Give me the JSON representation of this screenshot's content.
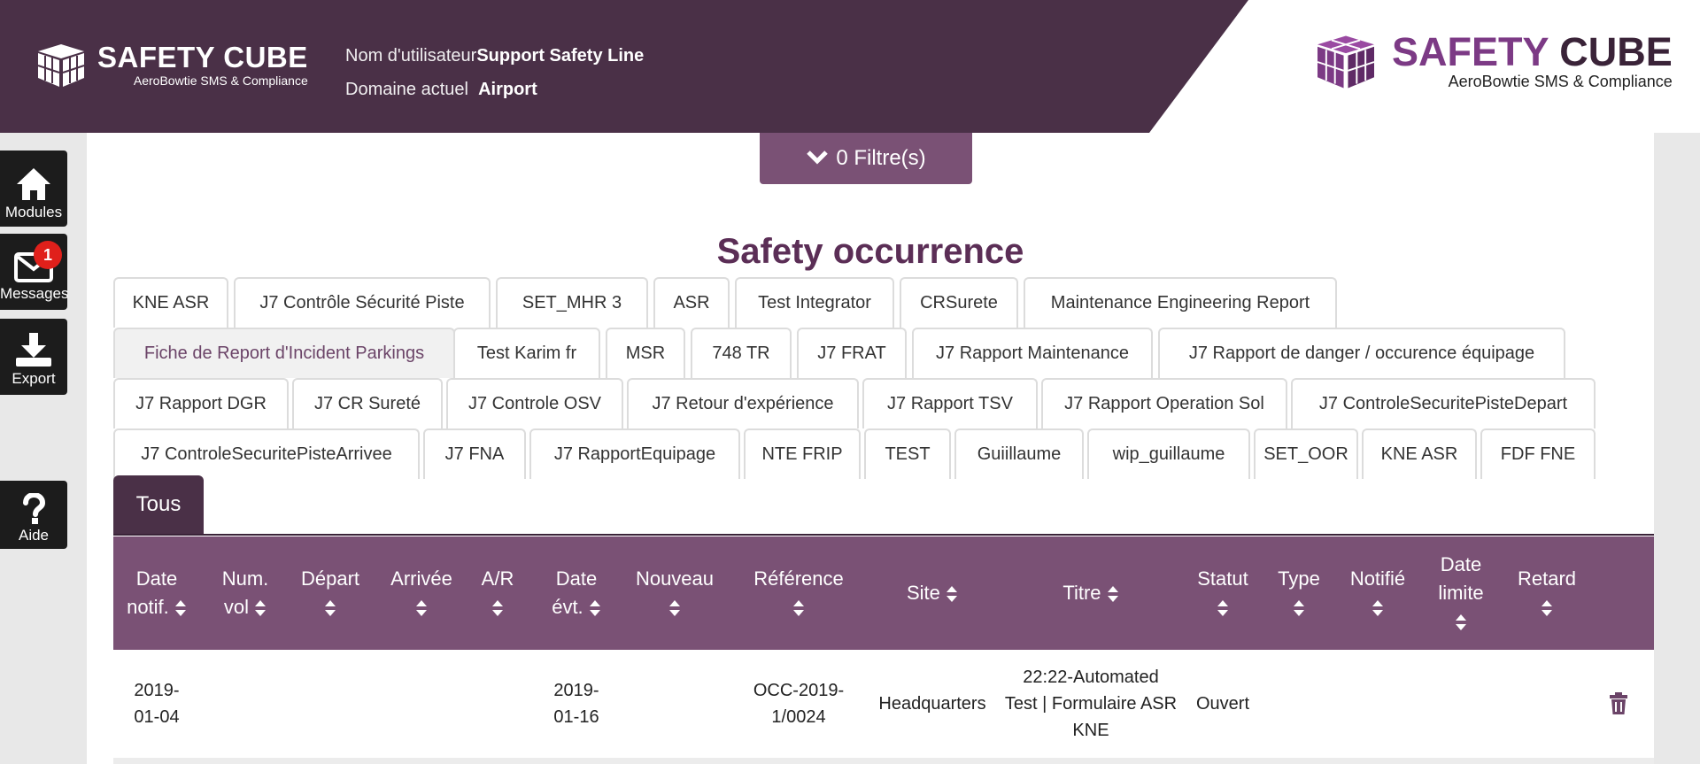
{
  "header": {
    "brand_name": "SAFETY CUBE",
    "brand_tagline": "AeroBowtie SMS & Compliance",
    "right_brand_part1": "SAFETY",
    "right_brand_part2": "CUBE",
    "right_tagline": "AeroBowtie SMS & Compliance",
    "user_label": "Nom d'utilisateur",
    "user_value": "Support Safety Line",
    "domain_label": "Domaine actuel",
    "domain_value": "Airport",
    "colors": {
      "header_bg": "#4a3047",
      "brand_purple": "#7c3a85"
    }
  },
  "sidebar": {
    "modules": {
      "label": "Modules",
      "icon": "home-icon"
    },
    "messages": {
      "label": "Messages",
      "icon": "envelope-icon",
      "badge": "1"
    },
    "export": {
      "label": "Export",
      "icon": "download-icon"
    },
    "help": {
      "label": "Aide",
      "icon": "question-icon"
    }
  },
  "filter": {
    "label": "0 Filtre(s)",
    "icon": "chevron-down-icon"
  },
  "page": {
    "title": "Safety occurrence"
  },
  "tabs": {
    "row1": [
      "KNE ASR",
      "J7 Contrôle Sécurité Piste",
      "SET_MHR 3",
      "ASR",
      "Test Integrator",
      "CRSurete",
      "Maintenance Engineering Report"
    ],
    "row2": [
      "Fiche de Report d'Incident Parkings",
      "Test Karim fr",
      "MSR",
      "748 TR",
      "J7 FRAT",
      "J7 Rapport Maintenance",
      "J7 Rapport de danger / occurence équipage"
    ],
    "row3": [
      "J7 Rapport DGR",
      "J7 CR Sureté",
      "J7 Controle OSV",
      "J7 Retour d'expérience",
      "J7 Rapport TSV",
      "J7 Rapport Operation Sol",
      "J7 ControleSecuritePisteDepart"
    ],
    "row4": [
      "J7 ControleSecuritePisteArrivee",
      "J7 FNA",
      "J7 RapportEquipage",
      "NTE FRIP",
      "TEST",
      "Guiillaume",
      "wip_guillaume",
      "SET_OOR",
      "KNE ASR",
      "FDF FNE"
    ],
    "all": "Tous"
  },
  "table": {
    "headers": [
      [
        "Date",
        "notif."
      ],
      [
        "Num.",
        "vol"
      ],
      [
        "Départ",
        ""
      ],
      [
        "Arrivée",
        ""
      ],
      [
        "A/R",
        ""
      ],
      [
        "Date",
        "évt."
      ],
      [
        "Nouveau",
        ""
      ],
      [
        "Référence",
        ""
      ],
      [
        "Site",
        ""
      ],
      [
        "Titre",
        ""
      ],
      [
        "Statut",
        ""
      ],
      [
        "Type",
        ""
      ],
      [
        "Notifié",
        ""
      ],
      [
        "Date",
        "limite"
      ],
      [
        "Retard",
        ""
      ]
    ],
    "rows": [
      {
        "date_notif": [
          "2019-",
          "01-04"
        ],
        "num_vol": "",
        "depart": "",
        "arrivee": "",
        "ar": "",
        "date_evt": [
          "2019-",
          "01-16"
        ],
        "nouveau": "",
        "reference": [
          "OCC-2019-",
          "1/0024"
        ],
        "site": "Headquarters",
        "titre": [
          "22:22-Automated",
          "Test | Formulaire ASR",
          "KNE"
        ],
        "statut": "Ouvert",
        "type": "",
        "notifie": "",
        "date_limite": "",
        "retard": "",
        "action_icon": "trash-icon"
      }
    ]
  }
}
